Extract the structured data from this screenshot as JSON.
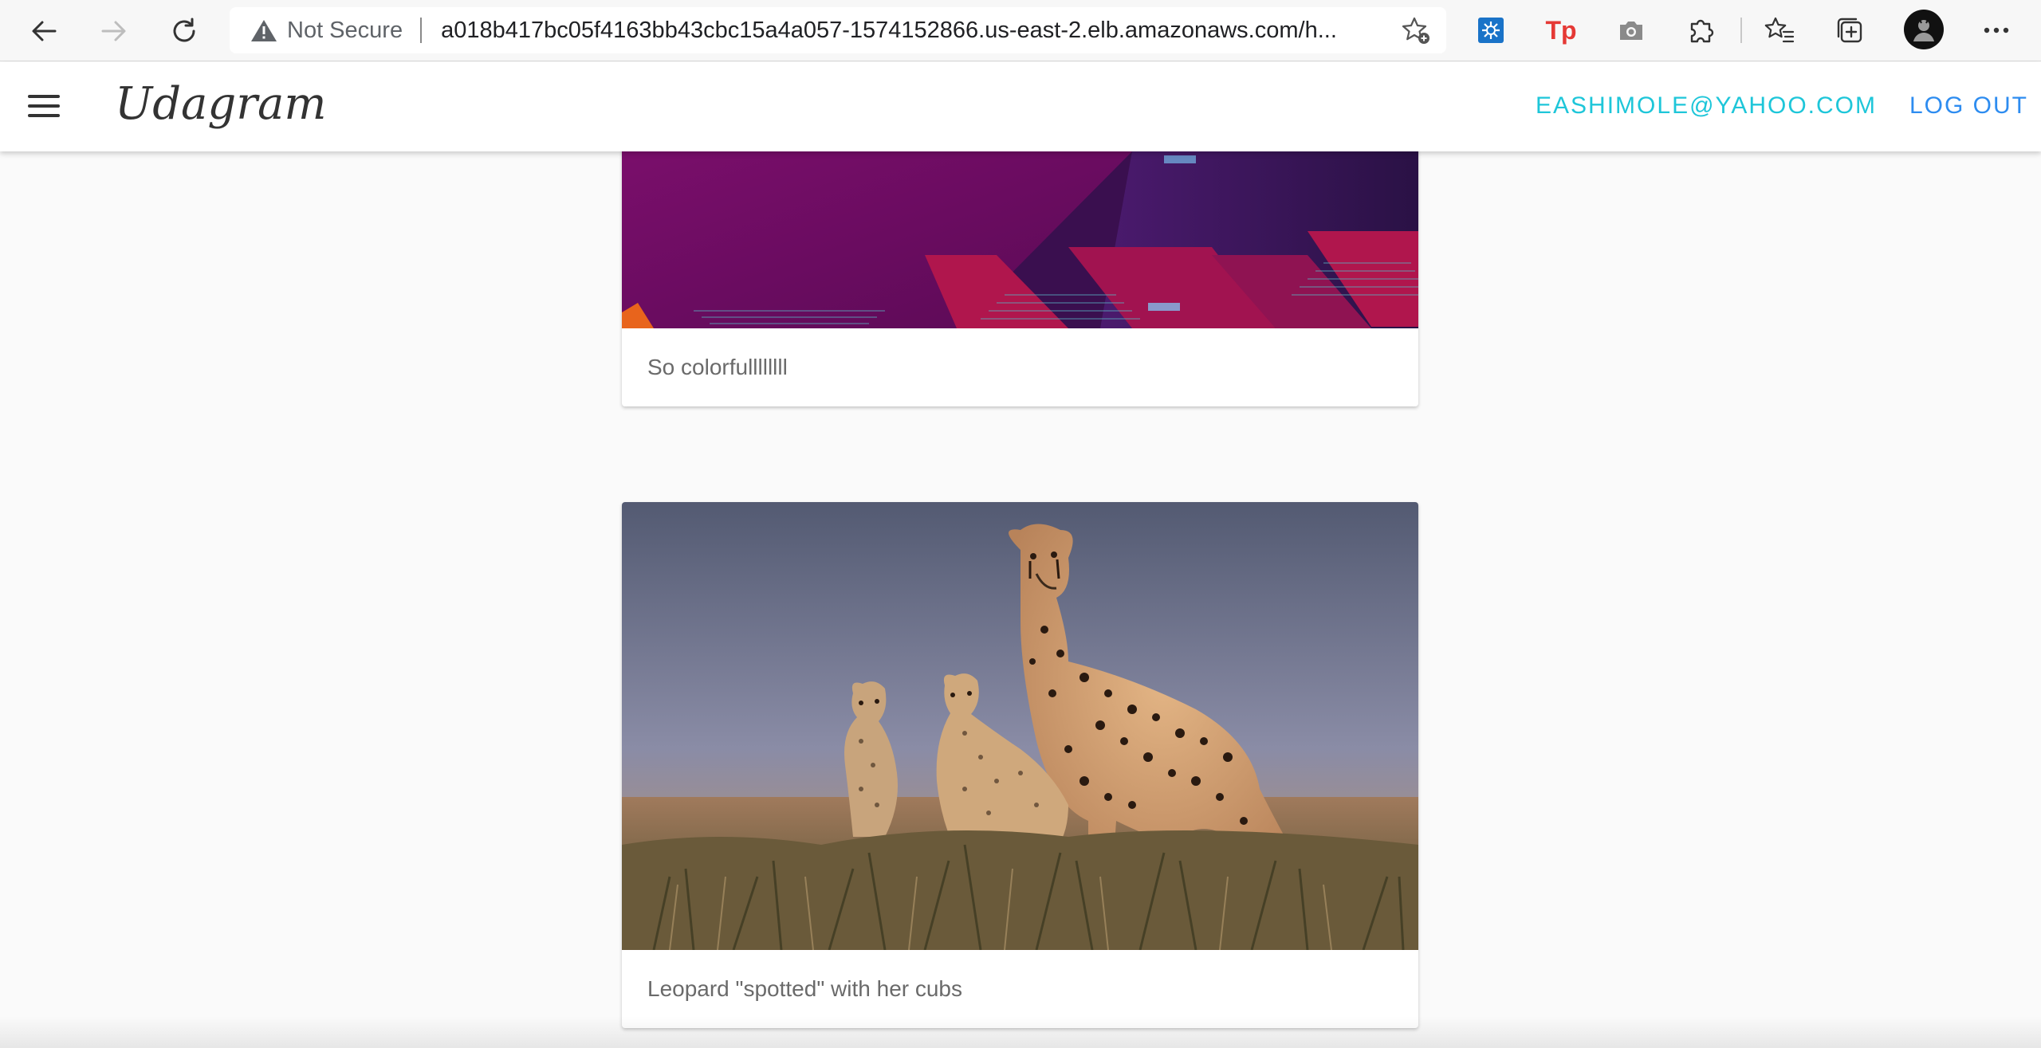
{
  "browser": {
    "security_label": "Not Secure",
    "url": "a018b417bc05f4163bb43cbc15a4a057-1574152866.us-east-2.elb.amazonaws.com/h...",
    "icons": [
      "back-icon",
      "forward-icon",
      "refresh-icon",
      "warning-icon",
      "favorite-add-icon",
      "extension-icon",
      "tp-extension-icon",
      "camera-icon",
      "puzzle-icon",
      "favorites-icon",
      "collections-icon",
      "profile-avatar",
      "more-icon"
    ],
    "tp_label": "Tp"
  },
  "app": {
    "brand": "Udagram",
    "user_email": "EASHIMOLE@YAHOO.COM",
    "logout_label": "LOG OUT",
    "colors": {
      "email": "#1ec6d9",
      "logout": "#2d8cf0"
    }
  },
  "feed": {
    "posts": [
      {
        "caption": "So colorfullllllll",
        "image": "purple-building-photo"
      },
      {
        "caption": "Leopard \"spotted\" with her cubs",
        "image": "cheetah-with-cubs-photo"
      }
    ]
  }
}
